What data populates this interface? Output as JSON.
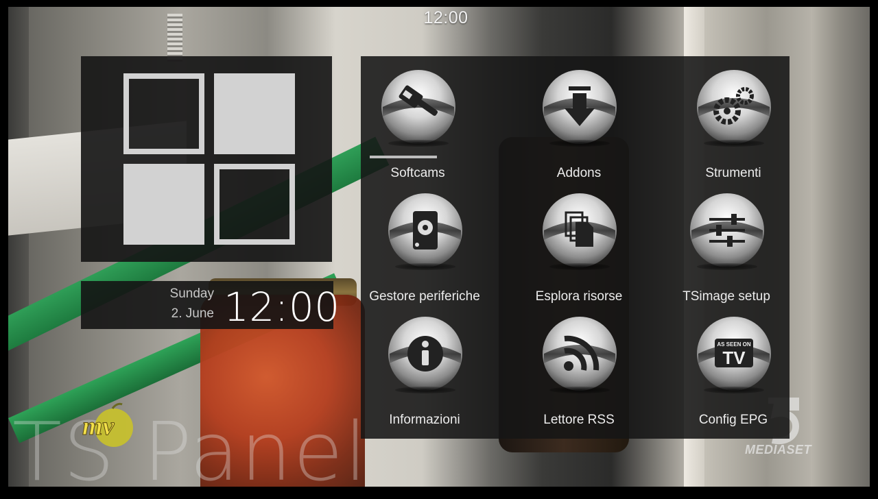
{
  "top_clock": "12:00",
  "clock_panel": {
    "day": "Sunday",
    "date": "2. June",
    "time": "12:00"
  },
  "menu": {
    "selected_index": 0,
    "items": [
      {
        "label": "Softcams",
        "icon": "key-icon"
      },
      {
        "label": "Addons",
        "icon": "download-arrow-icon"
      },
      {
        "label": "Strumenti",
        "icon": "gears-icon"
      },
      {
        "label": "Gestore periferiche",
        "icon": "hard-disk-icon"
      },
      {
        "label": "Esplora risorse",
        "icon": "documents-icon"
      },
      {
        "label": "TSimage setup",
        "icon": "sliders-icon"
      },
      {
        "label": "Informazioni",
        "icon": "info-icon"
      },
      {
        "label": "Lettore RSS",
        "icon": "rss-icon"
      },
      {
        "label": "Config EPG",
        "icon": "tv-icon"
      }
    ]
  },
  "tv_badge": {
    "line1": "AS SEEN ON",
    "line2": "TV"
  },
  "watermark": "TS Panel",
  "channel_logos": {
    "left": "mv",
    "right": "MEDIASET"
  },
  "colors": {
    "panel": "#161616",
    "tile": "#d2d2d2",
    "text": "#ececec"
  }
}
